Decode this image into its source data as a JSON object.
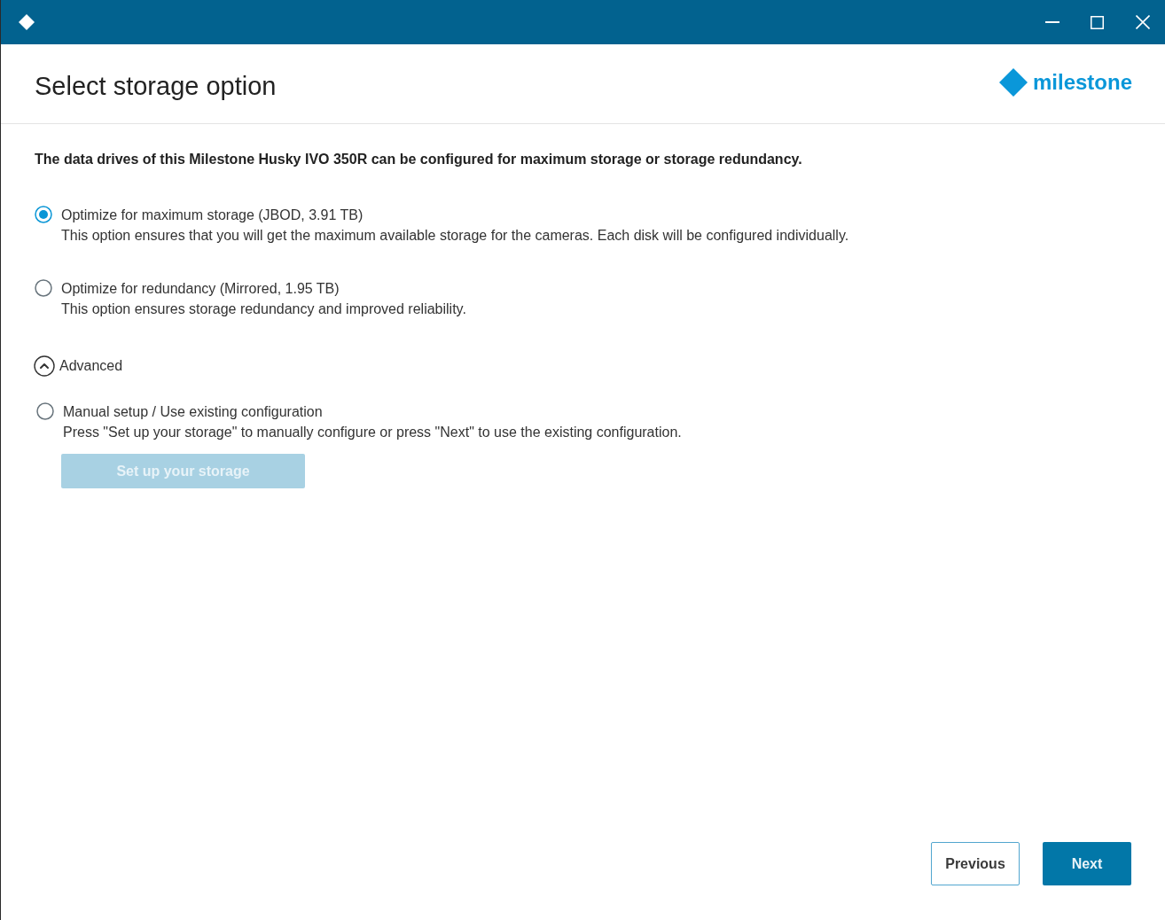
{
  "header": {
    "title": "Select storage option",
    "logo_text": "milestone"
  },
  "intro": "The data drives of this Milestone Husky IVO 350R can be configured for maximum storage or storage redundancy.",
  "options": [
    {
      "label": "Optimize for maximum storage (JBOD, 3.91 TB)",
      "description": "This option ensures that you will get the maximum available storage for the cameras. Each disk will be configured individually.",
      "selected": true
    },
    {
      "label": "Optimize for redundancy (Mirrored, 1.95 TB)",
      "description": "This option ensures storage redundancy and improved reliability.",
      "selected": false
    }
  ],
  "advanced": {
    "label": "Advanced",
    "expanded": true,
    "options": [
      {
        "label": "Manual setup / Use existing configuration",
        "description": "Press \"Set up your storage\" to manually configure or press \"Next\" to use the existing configuration.",
        "selected": false
      }
    ],
    "button": {
      "label": "Set up your storage",
      "disabled": true
    }
  },
  "buttons": [
    {
      "label": "Previous",
      "kind": "secondary"
    },
    {
      "label": "Next",
      "kind": "primary"
    }
  ]
}
